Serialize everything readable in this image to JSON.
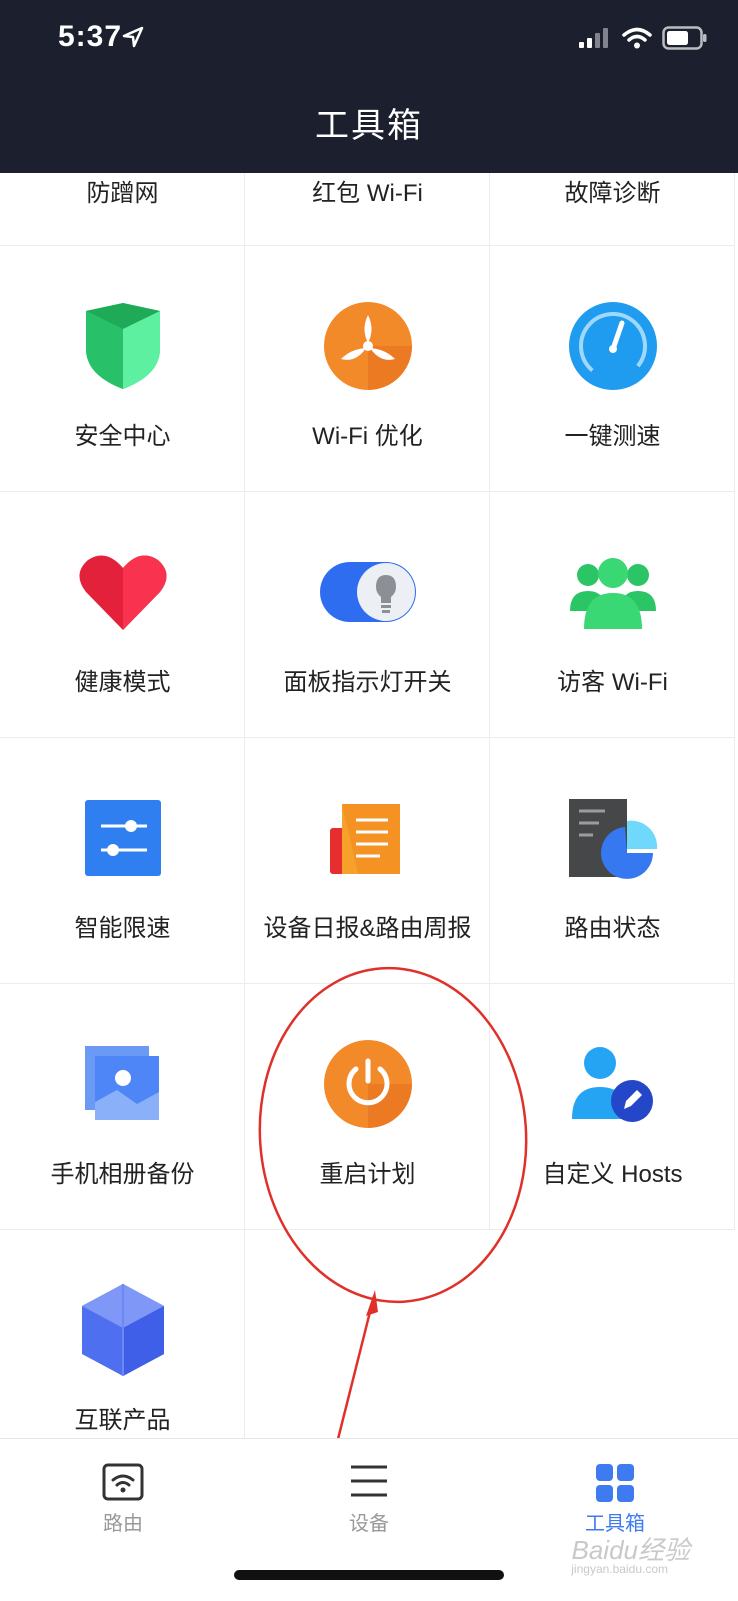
{
  "status": {
    "time": "5:37"
  },
  "header": {
    "title": "工具箱"
  },
  "partial_row": [
    "防蹭网",
    "红包 Wi-Fi",
    "故障诊断"
  ],
  "tools": [
    {
      "label": "安全中心",
      "icon": "shield-icon"
    },
    {
      "label": "Wi-Fi 优化",
      "icon": "fan-icon"
    },
    {
      "label": "一键测速",
      "icon": "speedometer-icon"
    },
    {
      "label": "健康模式",
      "icon": "heart-icon"
    },
    {
      "label": "面板指示灯开关",
      "icon": "bulb-toggle-icon"
    },
    {
      "label": "访客 Wi-Fi",
      "icon": "guests-icon"
    },
    {
      "label": "智能限速",
      "icon": "sliders-icon"
    },
    {
      "label": "设备日报&路由周报",
      "icon": "report-icon"
    },
    {
      "label": "路由状态",
      "icon": "status-chart-icon"
    },
    {
      "label": "手机相册备份",
      "icon": "photo-icon"
    },
    {
      "label": "重启计划",
      "icon": "power-icon"
    },
    {
      "label": "自定义 Hosts",
      "icon": "user-edit-icon"
    },
    {
      "label": "互联产品",
      "icon": "cube-icon"
    }
  ],
  "tabbar": {
    "items": [
      {
        "label": "路由",
        "icon": "router-icon",
        "active": false
      },
      {
        "label": "设备",
        "icon": "menu-icon",
        "active": false
      },
      {
        "label": "工具箱",
        "icon": "grid-icon",
        "active": true
      }
    ]
  },
  "watermark": {
    "text": "Baidu经验",
    "sub": "jingyan.baidu.com"
  },
  "colors": {
    "header_bg": "#1b1f2e",
    "active_tab": "#3e7bf0",
    "annotation": "#e0302a"
  }
}
